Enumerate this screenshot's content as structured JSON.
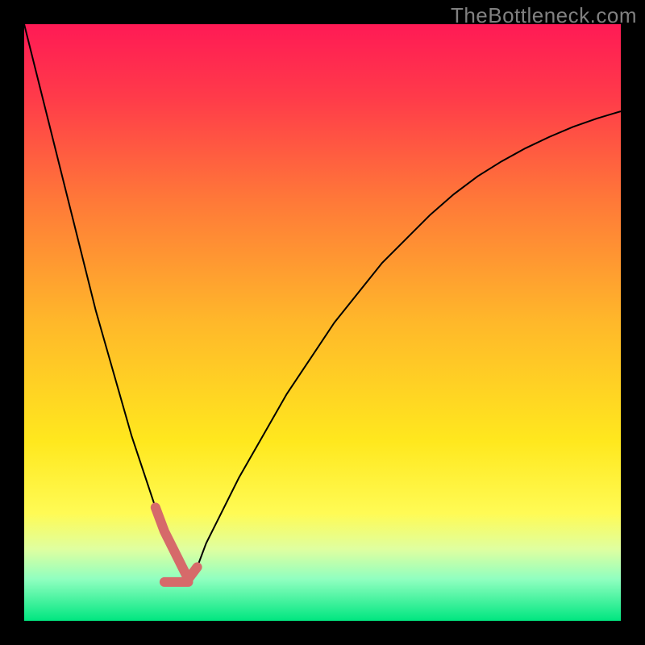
{
  "watermark": "TheBottleneck.com",
  "chart_data": {
    "type": "line",
    "title": "",
    "xlabel": "",
    "ylabel": "",
    "xlim": [
      0,
      100
    ],
    "ylim": [
      0,
      100
    ],
    "background_gradient": {
      "stops": [
        {
          "offset": 0.0,
          "color": "#ff1a55"
        },
        {
          "offset": 0.12,
          "color": "#ff3a4a"
        },
        {
          "offset": 0.3,
          "color": "#ff7a38"
        },
        {
          "offset": 0.5,
          "color": "#ffb82a"
        },
        {
          "offset": 0.7,
          "color": "#ffe81e"
        },
        {
          "offset": 0.82,
          "color": "#fffb55"
        },
        {
          "offset": 0.88,
          "color": "#dfffa0"
        },
        {
          "offset": 0.93,
          "color": "#90ffc0"
        },
        {
          "offset": 1.0,
          "color": "#00e680"
        }
      ]
    },
    "series": [
      {
        "name": "bottleneck-curve",
        "stroke": "#000000",
        "stroke_width": 2,
        "x": [
          0,
          2,
          4,
          6,
          8,
          10,
          12,
          14,
          16,
          18,
          20,
          22,
          23.5,
          25,
          26.5,
          27.5,
          29,
          30.5,
          33,
          36,
          40,
          44,
          48,
          52,
          56,
          60,
          64,
          68,
          72,
          76,
          80,
          84,
          88,
          92,
          96,
          100
        ],
        "y": [
          100,
          92,
          84,
          76,
          68,
          60,
          52,
          45,
          38,
          31,
          25,
          19,
          15,
          12,
          9,
          7,
          9,
          13,
          18,
          24,
          31,
          38,
          44,
          50,
          55,
          60,
          64,
          68,
          71.5,
          74.5,
          77,
          79.2,
          81.1,
          82.8,
          84.2,
          85.4
        ]
      },
      {
        "name": "highlighted-minimum",
        "stroke": "#d66a6a",
        "stroke_width": 12,
        "linecap": "round",
        "x": [
          22,
          23.5,
          25,
          26.5,
          27.5,
          29
        ],
        "y": [
          19,
          15,
          12,
          9,
          7,
          9
        ]
      },
      {
        "name": "highlighted-minimum-base",
        "stroke": "#d66a6a",
        "stroke_width": 12,
        "linecap": "round",
        "x": [
          23.5,
          27.5
        ],
        "y": [
          6.5,
          6.5
        ]
      }
    ]
  }
}
